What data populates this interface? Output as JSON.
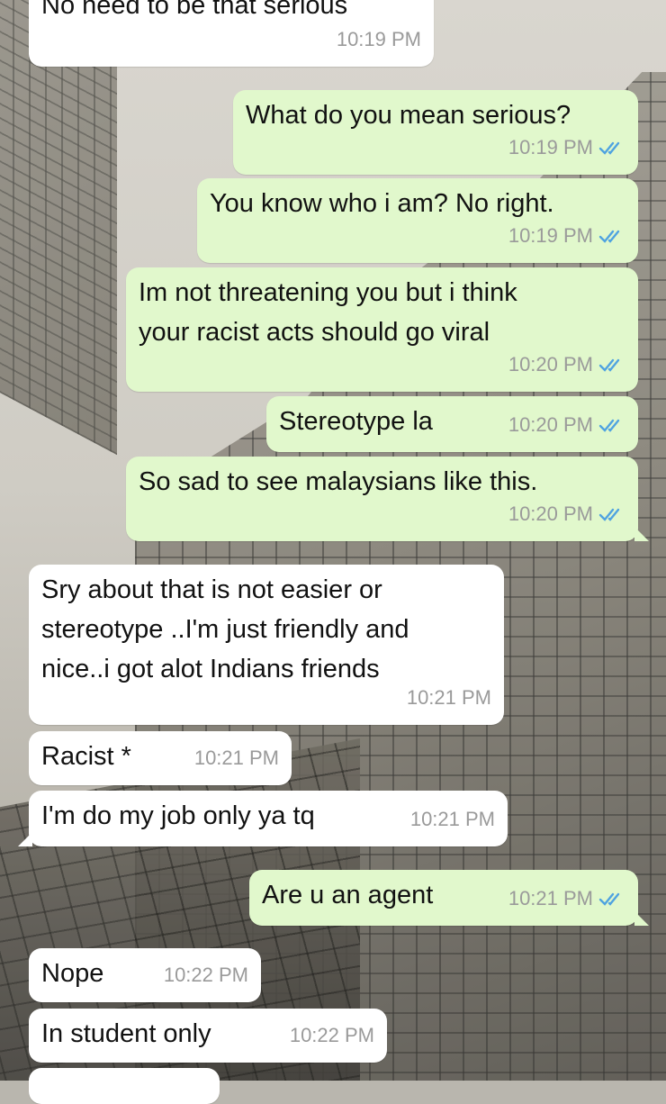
{
  "messages": [
    {
      "dir": "in",
      "text": "No need to be that serious",
      "time": "10:19 PM"
    },
    {
      "dir": "out",
      "text": "What do you mean serious?",
      "time": "10:19 PM"
    },
    {
      "dir": "out",
      "text": "You know who i am? No right.",
      "time": "10:19 PM"
    },
    {
      "dir": "out",
      "text": "Im not threatening you but i think\nyour racist acts should go viral",
      "time": "10:20 PM"
    },
    {
      "dir": "out",
      "text": "Stereotype la",
      "time": "10:20 PM"
    },
    {
      "dir": "out",
      "text": "So sad to see malaysians like this.",
      "time": "10:20 PM"
    },
    {
      "dir": "in",
      "text": "Sry about that is not easier or\nstereotype ..I'm just friendly and\nnice..i got alot Indians friends",
      "time": "10:21 PM"
    },
    {
      "dir": "in",
      "text": "Racist *",
      "time": "10:21 PM"
    },
    {
      "dir": "in",
      "text": "I'm do my job only ya tq",
      "time": "10:21 PM"
    },
    {
      "dir": "out",
      "text": "Are u an agent",
      "time": "10:21 PM"
    },
    {
      "dir": "in",
      "text": "Nope",
      "time": "10:22 PM"
    },
    {
      "dir": "in",
      "text": "In student only",
      "time": "10:22 PM"
    }
  ],
  "colors": {
    "incoming": "#ffffff",
    "outgoing": "#e1f8cc",
    "read_ticks": "#4fa3e0",
    "timestamp": "#9a9a9a"
  },
  "icons": {
    "read_receipt": "double-check-icon"
  }
}
